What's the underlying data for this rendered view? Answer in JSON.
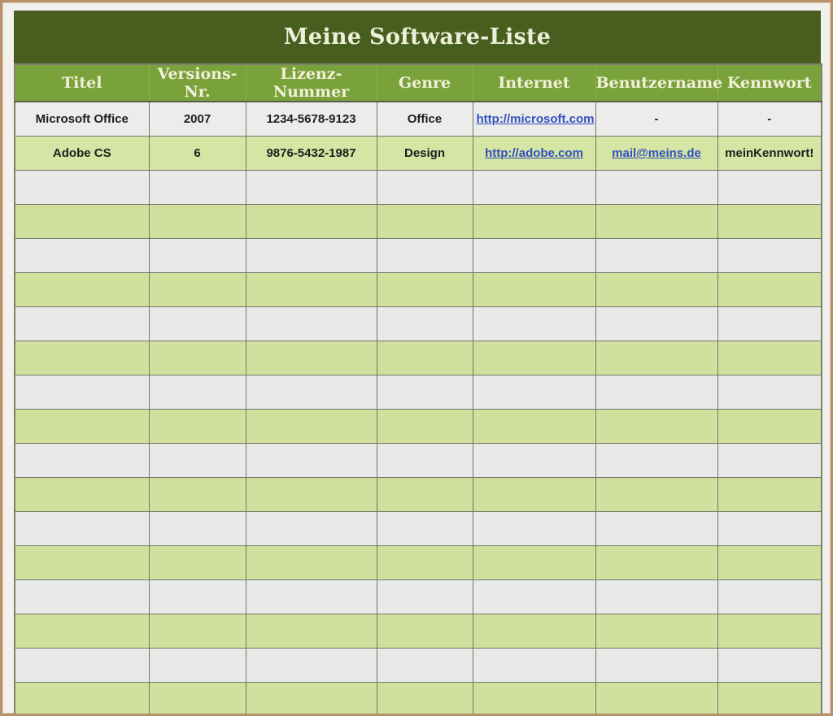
{
  "title": "Meine Software-Liste",
  "table": {
    "columns": [
      {
        "key": "titel",
        "label": "Titel"
      },
      {
        "key": "versions-nr",
        "label": "Versions-Nr."
      },
      {
        "key": "lizenz-nummer",
        "label": "Lizenz-Nummer"
      },
      {
        "key": "genre",
        "label": "Genre"
      },
      {
        "key": "internet",
        "label": "Internet"
      },
      {
        "key": "benutzername",
        "label": "Benutzername"
      },
      {
        "key": "kennwort",
        "label": "Kennwort"
      }
    ],
    "rows": [
      {
        "variant": "gray",
        "cells": [
          {
            "text": "Microsoft Office"
          },
          {
            "text": "2007"
          },
          {
            "text": "1234-5678-9123"
          },
          {
            "text": "Office"
          },
          {
            "text": "http://microsoft.com",
            "link": true
          },
          {
            "text": "-"
          },
          {
            "text": "-"
          }
        ]
      },
      {
        "variant": "green",
        "cells": [
          {
            "text": "Adobe CS"
          },
          {
            "text": "6"
          },
          {
            "text": "9876-5432-1987"
          },
          {
            "text": "Design"
          },
          {
            "text": "http://adobe.com",
            "link": true
          },
          {
            "text": "mail@meins.de",
            "link": true
          },
          {
            "text": "meinKennwort!"
          }
        ]
      }
    ],
    "empty_row_count": 16
  },
  "colors": {
    "frame_border": "#b8906a",
    "title_bar_bg": "#475e1f",
    "title_text": "#edf0d9",
    "header_bg": "#7aa23b",
    "header_text": "#f2f0da",
    "row_gray": "#e9e9e7",
    "row_green": "#cfe19c",
    "grid_border": "#73766a",
    "link_blue": "#3250c0"
  }
}
